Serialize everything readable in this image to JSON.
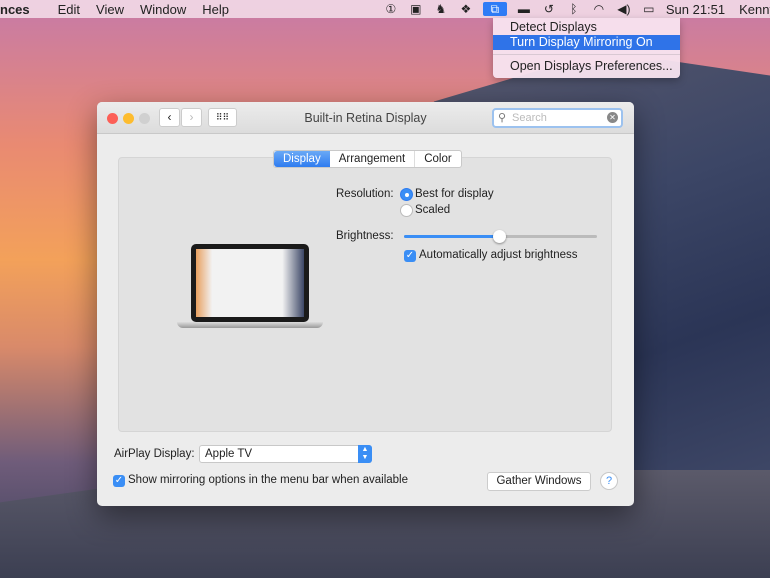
{
  "menubar": {
    "app": "nces",
    "items": [
      "Edit",
      "View",
      "Window",
      "Help"
    ],
    "clock": "Sun 21:51",
    "user": "Kenny",
    "status_icons": [
      "onepassword-icon",
      "app-icon",
      "evernote-icon",
      "dropbox-icon",
      "display-mirroring-icon",
      "monitor-icon",
      "time-machine-icon",
      "bluetooth-icon",
      "wifi-icon",
      "volume-icon",
      "battery-icon"
    ]
  },
  "dropdown": {
    "items": [
      "Detect Displays",
      "Turn Display Mirroring On",
      "Open Displays Preferences..."
    ],
    "highlighted": "Turn Display Mirroring On"
  },
  "window": {
    "title": "Built-in Retina Display",
    "search_placeholder": "Search",
    "tabs": [
      "Display",
      "Arrangement",
      "Color"
    ],
    "active_tab": "Display",
    "resolution_label": "Resolution:",
    "resolution_options": [
      "Best for display",
      "Scaled"
    ],
    "resolution_selected": "Best for display",
    "brightness_label": "Brightness:",
    "brightness_value": 0.49,
    "auto_brightness_label": "Automatically adjust brightness",
    "auto_brightness": true,
    "airplay_label": "AirPlay Display:",
    "airplay_value": "Apple TV",
    "mirroring_label": "Show mirroring options in the menu bar when available",
    "mirroring": true,
    "gather_label": "Gather Windows",
    "help_label": "?"
  },
  "colors": {
    "accent": "#2f7cf0",
    "highlight": "#2f73e8"
  }
}
